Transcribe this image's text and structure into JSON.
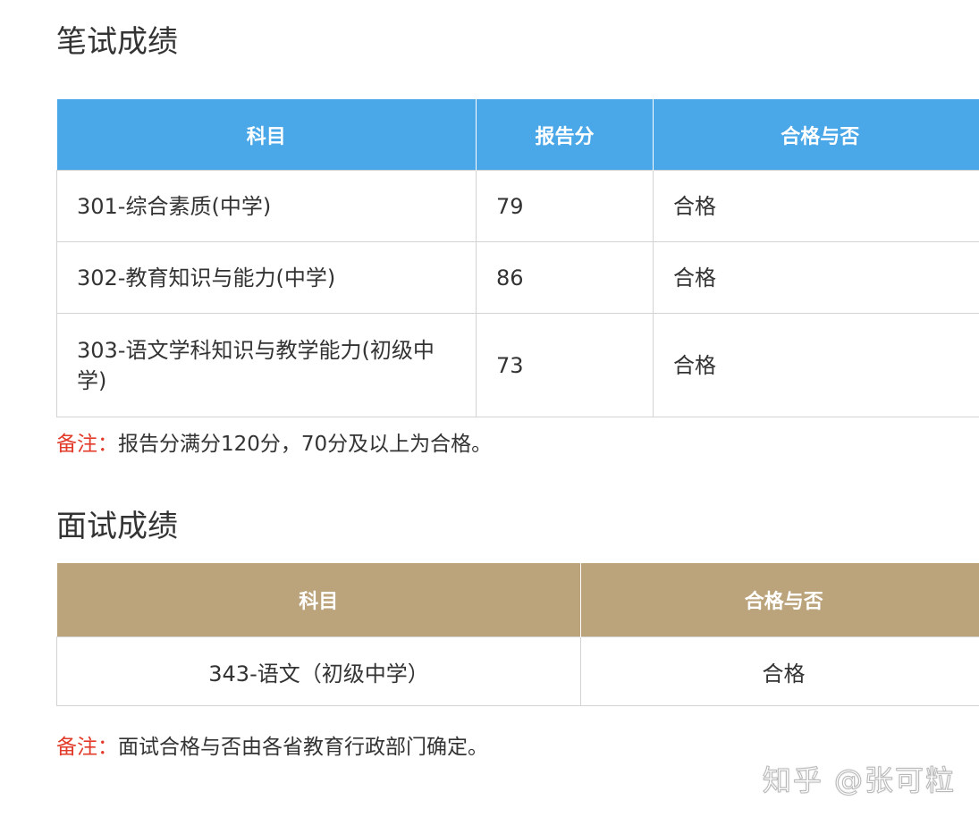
{
  "written": {
    "title": "笔试成绩",
    "headers": [
      "科目",
      "报告分",
      "合格与否"
    ],
    "rows": [
      {
        "subject": "301-综合素质(中学)",
        "score": "79",
        "result": "合格"
      },
      {
        "subject": "302-教育知识与能力(中学)",
        "score": "86",
        "result": "合格"
      },
      {
        "subject": "303-语文学科知识与教学能力(初级中学)",
        "score": "73",
        "result": "合格"
      }
    ],
    "note_label": "备注：",
    "note_text": "报告分满分120分，70分及以上为合格。"
  },
  "interview": {
    "title": "面试成绩",
    "headers": [
      "科目",
      "合格与否"
    ],
    "rows": [
      {
        "subject": "343-语文（初级中学）",
        "result": "合格"
      }
    ],
    "note_label": "备注：",
    "note_text": "面试合格与否由各省教育行政部门确定。"
  },
  "watermark": "知乎 @张可粒",
  "colors": {
    "written_header_bg": "#4aa7e8",
    "interview_header_bg": "#bba37b",
    "note_label": "#e23b2a"
  }
}
